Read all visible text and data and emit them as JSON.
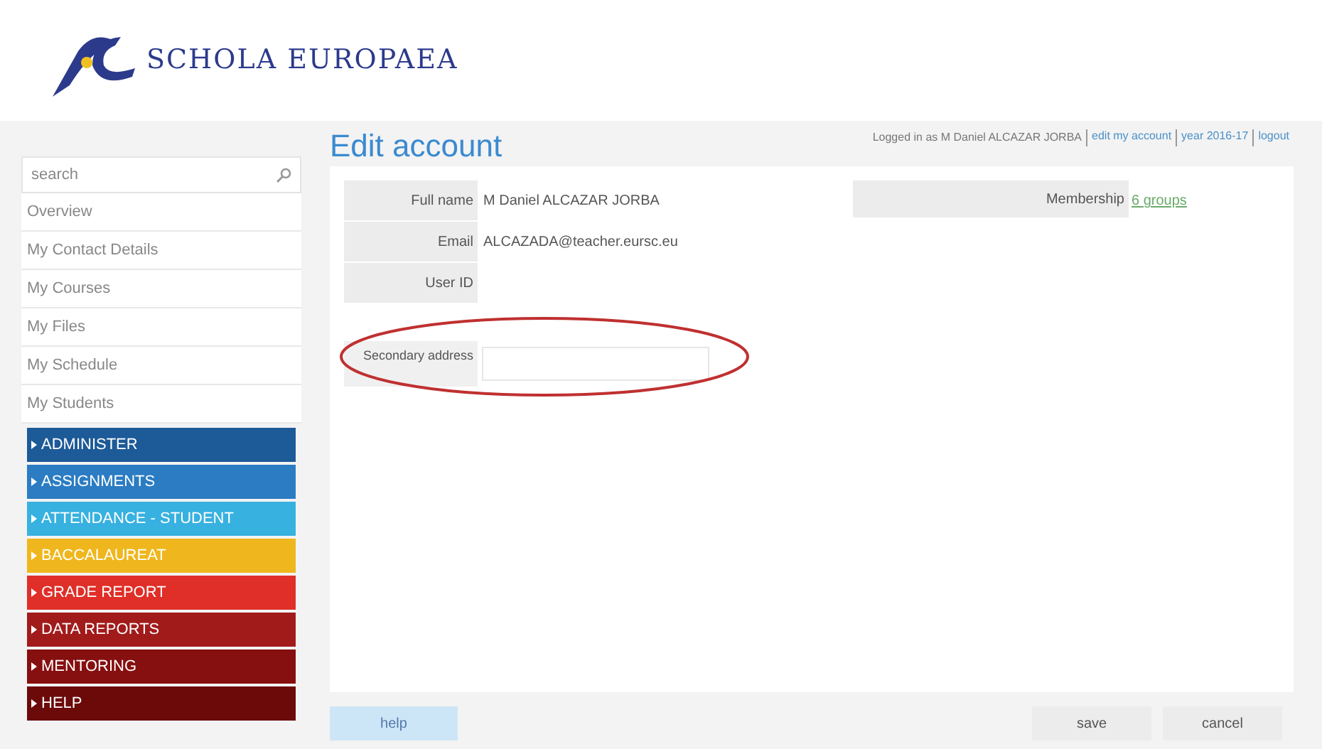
{
  "header": {
    "logo_text": "SCHOLA EUROPAEA",
    "login_text": "Logged in as M Daniel ALCAZAR JORBA",
    "links": [
      "edit my account",
      "year 2016-17",
      "logout"
    ]
  },
  "sidebar": {
    "search": {
      "placeholder": "search"
    },
    "items": [
      {
        "label": "Overview"
      },
      {
        "label": "My Contact Details"
      },
      {
        "label": "My Courses"
      },
      {
        "label": "My Files"
      },
      {
        "label": "My Schedule"
      },
      {
        "label": "My Students"
      }
    ],
    "menus": [
      {
        "label": "ADMINISTER",
        "color": "#1d5a98"
      },
      {
        "label": "ASSIGNMENTS",
        "color": "#2b7cc2"
      },
      {
        "label": "ATTENDANCE - STUDENT",
        "color": "#37b1e0"
      },
      {
        "label": "BACCALAUREAT",
        "color": "#efb71d"
      },
      {
        "label": "GRADE REPORT",
        "color": "#df2f28"
      },
      {
        "label": "DATA REPORTS",
        "color": "#a21b1b"
      },
      {
        "label": "MENTORING",
        "color": "#860f0f"
      },
      {
        "label": "HELP",
        "color": "#6c0a0a"
      }
    ]
  },
  "page": {
    "title": "Edit account",
    "fields": [
      {
        "label": "Full name",
        "value": "M Daniel ALCAZAR JORBA"
      },
      {
        "label": "Email",
        "value": "ALCAZADA@teacher.eursc.eu"
      },
      {
        "label": "User ID"
      }
    ],
    "membership": {
      "label": "Membership",
      "link": "6 groups"
    },
    "secondary_address": {
      "label": "Secondary address"
    },
    "buttons": {
      "help": "help",
      "save": "save",
      "cancel": "cancel"
    }
  }
}
